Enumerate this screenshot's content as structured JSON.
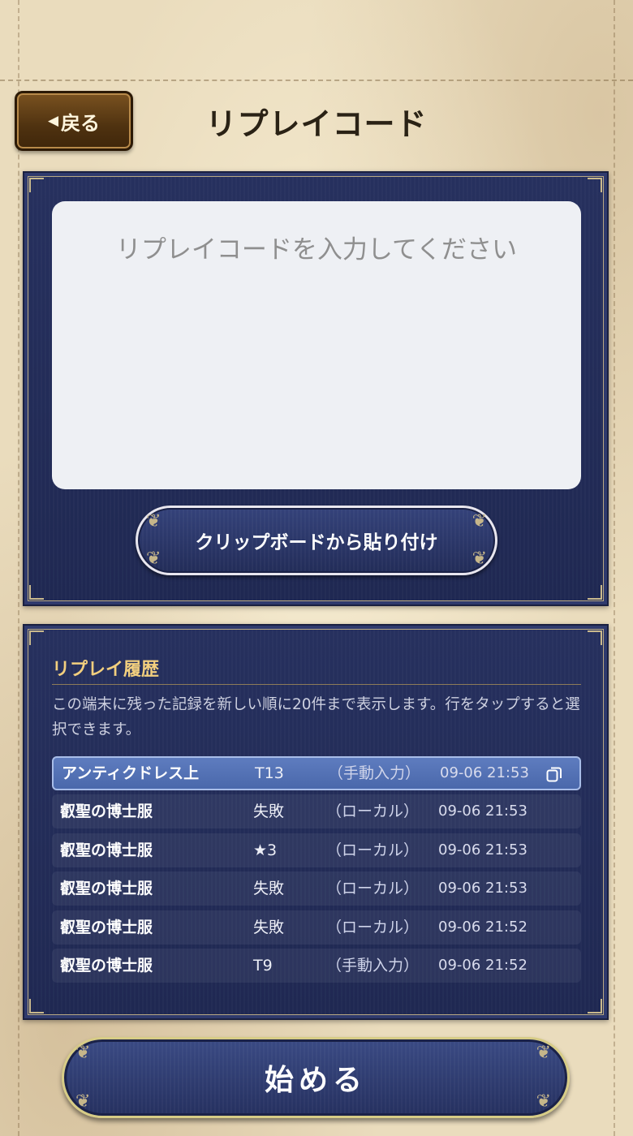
{
  "header": {
    "back_label": "戻る",
    "title": "リプレイコード"
  },
  "code_panel": {
    "placeholder": "リプレイコードを入力してください",
    "value": "",
    "paste_button_label": "クリップボードから貼り付け"
  },
  "history": {
    "title": "リプレイ履歴",
    "description": "この端末に残った記録を新しい順に20件まで表示します。行をタップすると選択できます。",
    "rows": [
      {
        "name": "アンティクドレス上",
        "result": "T13",
        "source": "（手動入力）",
        "time": "09-06 21:53",
        "selected": true
      },
      {
        "name": "叡聖の博士服",
        "result": "失敗",
        "source": "（ローカル）",
        "time": "09-06 21:53",
        "selected": false
      },
      {
        "name": "叡聖の博士服",
        "result": "★3",
        "source": "（ローカル）",
        "time": "09-06 21:53",
        "selected": false
      },
      {
        "name": "叡聖の博士服",
        "result": "失敗",
        "source": "（ローカル）",
        "time": "09-06 21:53",
        "selected": false
      },
      {
        "name": "叡聖の博士服",
        "result": "失敗",
        "source": "（ローカル）",
        "time": "09-06 21:52",
        "selected": false
      },
      {
        "name": "叡聖の博士服",
        "result": "T9",
        "source": "（手動入力）",
        "time": "09-06 21:52",
        "selected": false
      }
    ]
  },
  "start_button_label": "始める",
  "colors": {
    "panel_navy": "#26305e",
    "accent_gold": "#f2cf7e",
    "selected_row": "#5e7cbf",
    "back_button_brown": "#4f3210",
    "parchment": "#eadcbd"
  },
  "icons": {
    "back_arrow": "left-triangle",
    "copy": "copy-icon"
  }
}
